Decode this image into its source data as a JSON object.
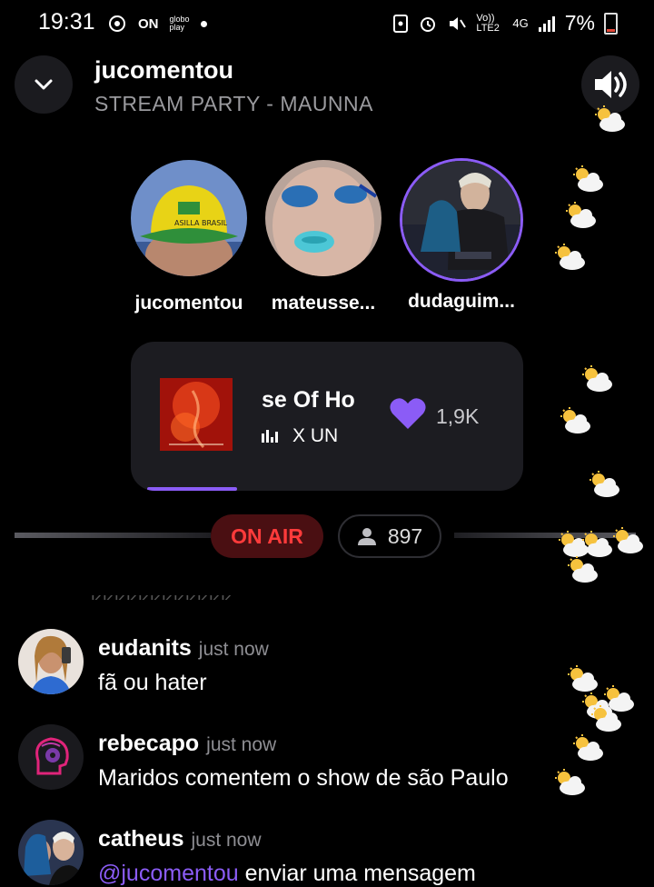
{
  "status_bar": {
    "time": "19:31",
    "left_icons": [
      "location-icon",
      "on-icon",
      "globoplay-icon",
      "dot-icon"
    ],
    "on_label": "ON",
    "globoplay_label": "globo play",
    "network_volte": "Vo)) LTE2",
    "network_4g": "4G",
    "battery": "7%"
  },
  "header": {
    "title": "jucomentou",
    "subtitle": "STREAM PARTY - MAUNNA"
  },
  "participants": [
    {
      "name": "jucomentou"
    },
    {
      "name": "mateusse..."
    },
    {
      "name": "dudaguim..."
    }
  ],
  "now_playing": {
    "track": "se Of Ho",
    "artist": "X UN",
    "likes": "1,9K",
    "progress": 0.25
  },
  "live": {
    "on_air_label": "ON AIR",
    "viewer_count": "897"
  },
  "cutoff_text": "KKKKKKKKKKKK",
  "comments": [
    {
      "author": "eudanits",
      "time": "just now",
      "text": "fã ou hater"
    },
    {
      "author": "rebecapo",
      "time": "just now",
      "text": "Maridos comentem o show de são Paulo"
    },
    {
      "author": "catheus",
      "time": "just now",
      "mention": "@jucomentou",
      "text": "enviar uma mensagem"
    }
  ],
  "colors": {
    "accent": "#8b5cf6",
    "on_air_red": "#ff3b3b",
    "background": "#000000",
    "card": "#1c1c21"
  }
}
